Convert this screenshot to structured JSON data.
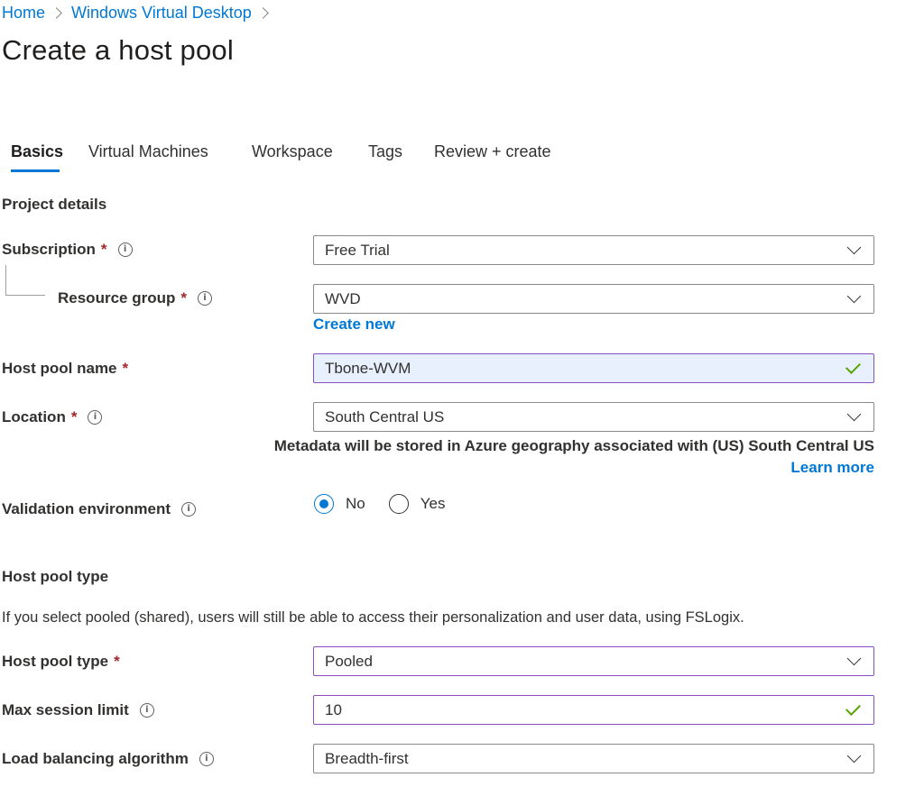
{
  "breadcrumb": {
    "items": [
      "Home",
      "Windows Virtual Desktop"
    ]
  },
  "page_title": "Create a host pool",
  "tabs": [
    {
      "label": "Basics",
      "active": true
    },
    {
      "label": "Virtual Machines",
      "active": false
    },
    {
      "label": "Workspace",
      "active": false
    },
    {
      "label": "Tags",
      "active": false
    },
    {
      "label": "Review + create",
      "active": false
    }
  ],
  "project_details": {
    "title": "Project details",
    "subscription": {
      "label": "Subscription",
      "required": "*",
      "value": "Free Trial"
    },
    "resource_group": {
      "label": "Resource group",
      "required": "*",
      "value": "WVD",
      "create_new": "Create new"
    }
  },
  "host_pool_name": {
    "label": "Host pool name",
    "required": "*",
    "value": "Tbone-WVM"
  },
  "location": {
    "label": "Location",
    "required": "*",
    "value": "South Central US",
    "help": "Metadata will be stored in Azure geography associated with (US) South Central US",
    "learn_more": "Learn more"
  },
  "validation_environment": {
    "label": "Validation environment",
    "options": [
      "No",
      "Yes"
    ],
    "selected": "No"
  },
  "host_pool_type_section": {
    "title": "Host pool type",
    "description": "If you select pooled (shared), users will still be able to access their personalization and user data, using FSLogix.",
    "host_pool_type": {
      "label": "Host pool type",
      "required": "*",
      "value": "Pooled"
    },
    "max_session_limit": {
      "label": "Max session limit",
      "value": "10"
    },
    "load_balancing": {
      "label": "Load balancing algorithm",
      "value": "Breadth-first"
    }
  },
  "icons": {
    "info": "i"
  },
  "colors": {
    "accent": "#0078d4",
    "required": "#a4262c",
    "focus_border": "#8a4fbf",
    "valid": "#57a300"
  }
}
